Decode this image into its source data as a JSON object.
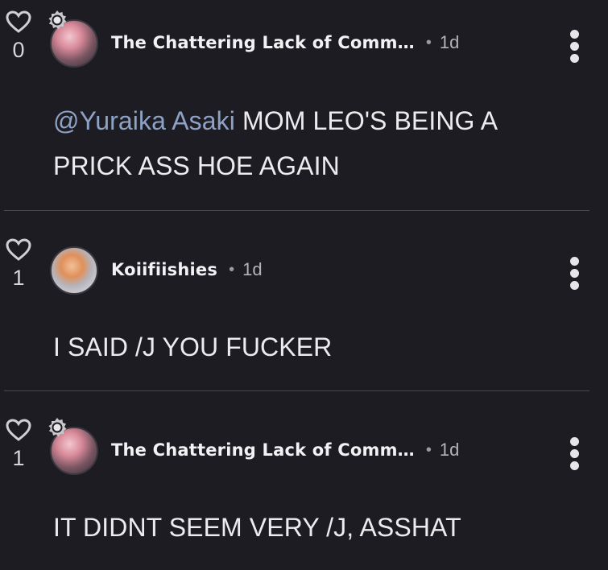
{
  "comments": [
    {
      "likes": "0",
      "author": "The Chattering Lack of Comm…",
      "time": "1d",
      "mention": "@Yuraika Asaki",
      "text_line1": " MOM LEO'S BEING A",
      "text_line2": "PRICK ASS HOE AGAIN",
      "has_badge": true
    },
    {
      "likes": "1",
      "author": "Koiifiishies",
      "time": "1d",
      "text": "I SAID /J YOU FUCKER",
      "has_badge": false
    },
    {
      "likes": "1",
      "author": "The Chattering Lack of Comm…",
      "time": "1d",
      "text": "IT DIDNT SEEM VERY /J, ASSHAT",
      "has_badge": true
    }
  ],
  "separator": "•",
  "icons": {
    "like": "heart-outline-icon",
    "menu": "more-vertical-icon",
    "badge": "chat-bubble-badge-icon"
  },
  "colors": {
    "background": "#1d1c22",
    "mention": "#8ea2c6",
    "divider": "#4a4950"
  }
}
